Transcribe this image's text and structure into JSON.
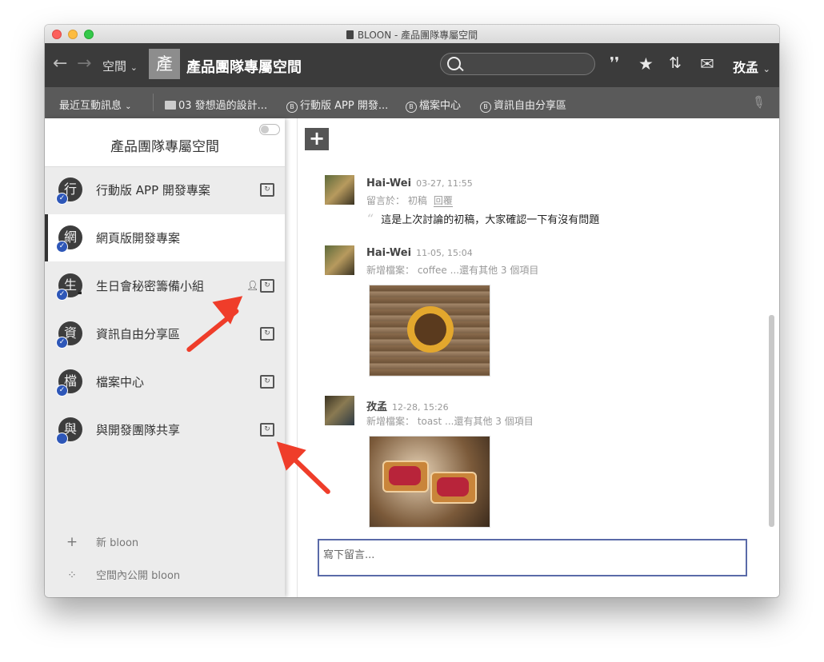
{
  "window": {
    "title": "BLOON - 產品團隊專屬空間"
  },
  "toolbar": {
    "back_icon": "arrow-left-icon",
    "forward_icon": "arrow-right-icon",
    "spaces_label": "空間",
    "space_icon_char": "產",
    "space_name": "產品團隊專屬空間",
    "search_placeholder": "",
    "user_name": "孜孟"
  },
  "bookmarks": {
    "recent_label": "最近互動訊息",
    "items": [
      {
        "label": "03 發想過的設計...",
        "icon": "folder-icon"
      },
      {
        "label": "行動版 APP 開發...",
        "icon": "b-circle-icon"
      },
      {
        "label": "檔案中心",
        "icon": "b-circle-icon"
      },
      {
        "label": "資訊自由分享區",
        "icon": "b-circle-icon"
      }
    ]
  },
  "sidebar": {
    "title": "產品團隊專屬空間",
    "items": [
      {
        "label": "行動版 APP 開發專案",
        "avatar": "行",
        "active": false,
        "locked": false,
        "shared_member": false
      },
      {
        "label": "網頁版開發專案",
        "avatar": "網",
        "active": true,
        "locked": false,
        "shared_member": false
      },
      {
        "label": "生日會秘密籌備小組",
        "avatar": "生",
        "active": false,
        "locked": true,
        "shared_member": true
      },
      {
        "label": "資訊自由分享區",
        "avatar": "資",
        "active": false,
        "locked": false,
        "shared_member": false
      },
      {
        "label": "檔案中心",
        "avatar": "檔",
        "active": false,
        "locked": false,
        "shared_member": false
      },
      {
        "label": "與開發團隊共享",
        "avatar": "與",
        "active": false,
        "locked": false,
        "shared_member": false
      }
    ],
    "footer": {
      "new_bloon": "新 bloon",
      "public_bloon": "空間內公開 bloon"
    }
  },
  "feed": {
    "posts": [
      {
        "author": "Hai-Wei",
        "date": "03-27, 11:55",
        "meta": "留言於： 初稿",
        "reply_link": "回覆",
        "quote": "這是上次討論的初稿，大家確認一下有沒有問題"
      },
      {
        "author": "Hai-Wei",
        "date": "11-05, 15:04",
        "meta": "新增檔案： coffee",
        "more": "...還有其他 3 個項目"
      },
      {
        "author": "孜孟",
        "date": "12-28, 15:26",
        "meta": "新增檔案： toast",
        "more": "...還有其他 3 個項目"
      }
    ],
    "comment_placeholder": "寫下留言..."
  },
  "colors": {
    "toolbar_bg": "#3b3b3b",
    "bookmark_bg": "#5a5a5a",
    "accent_blue": "#2e57b8",
    "annotation_red": "#ef3d2a"
  }
}
